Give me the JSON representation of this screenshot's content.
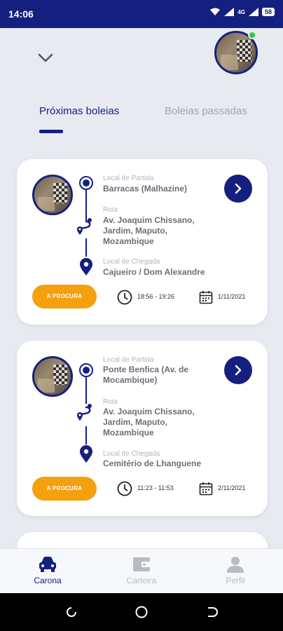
{
  "status_bar": {
    "time": "14:06",
    "network": "4G",
    "battery": "58"
  },
  "tabs": [
    {
      "label": "Próximas boleias",
      "active": true
    },
    {
      "label": "Boleias passadas",
      "active": false
    }
  ],
  "labels": {
    "departure": "Local de Partida",
    "route": "Rota",
    "arrival": "Local de Chegada"
  },
  "rides": [
    {
      "departure": "Barracas (Malhazine)",
      "route": "Av. Joaquim Chissano, Jardim, Maputo, Mozambique",
      "arrival": "Cajueiro / Dom Alexandre",
      "status": "A PROCURA",
      "time": "18:56 - 19:26",
      "date": "1/11/2021"
    },
    {
      "departure": "Ponte Benfica (Av. de Mocambique)",
      "route": "Av. Joaquim Chissano, Jardim, Maputo, Mozambique",
      "arrival": "Cemitério de Lhanguene",
      "status": "A PROCURA",
      "time": "11:23 - 11:53",
      "date": "2/11/2021"
    }
  ],
  "bottom_nav": [
    {
      "label": "Carona",
      "icon": "car-icon",
      "active": true
    },
    {
      "label": "Carteira",
      "icon": "wallet-icon",
      "active": false
    },
    {
      "label": "Perfil",
      "icon": "person-icon",
      "active": false
    }
  ],
  "colors": {
    "primary": "#142080",
    "accent": "#f5a00f",
    "background": "#e8eaf2",
    "online": "#2ecc40"
  }
}
